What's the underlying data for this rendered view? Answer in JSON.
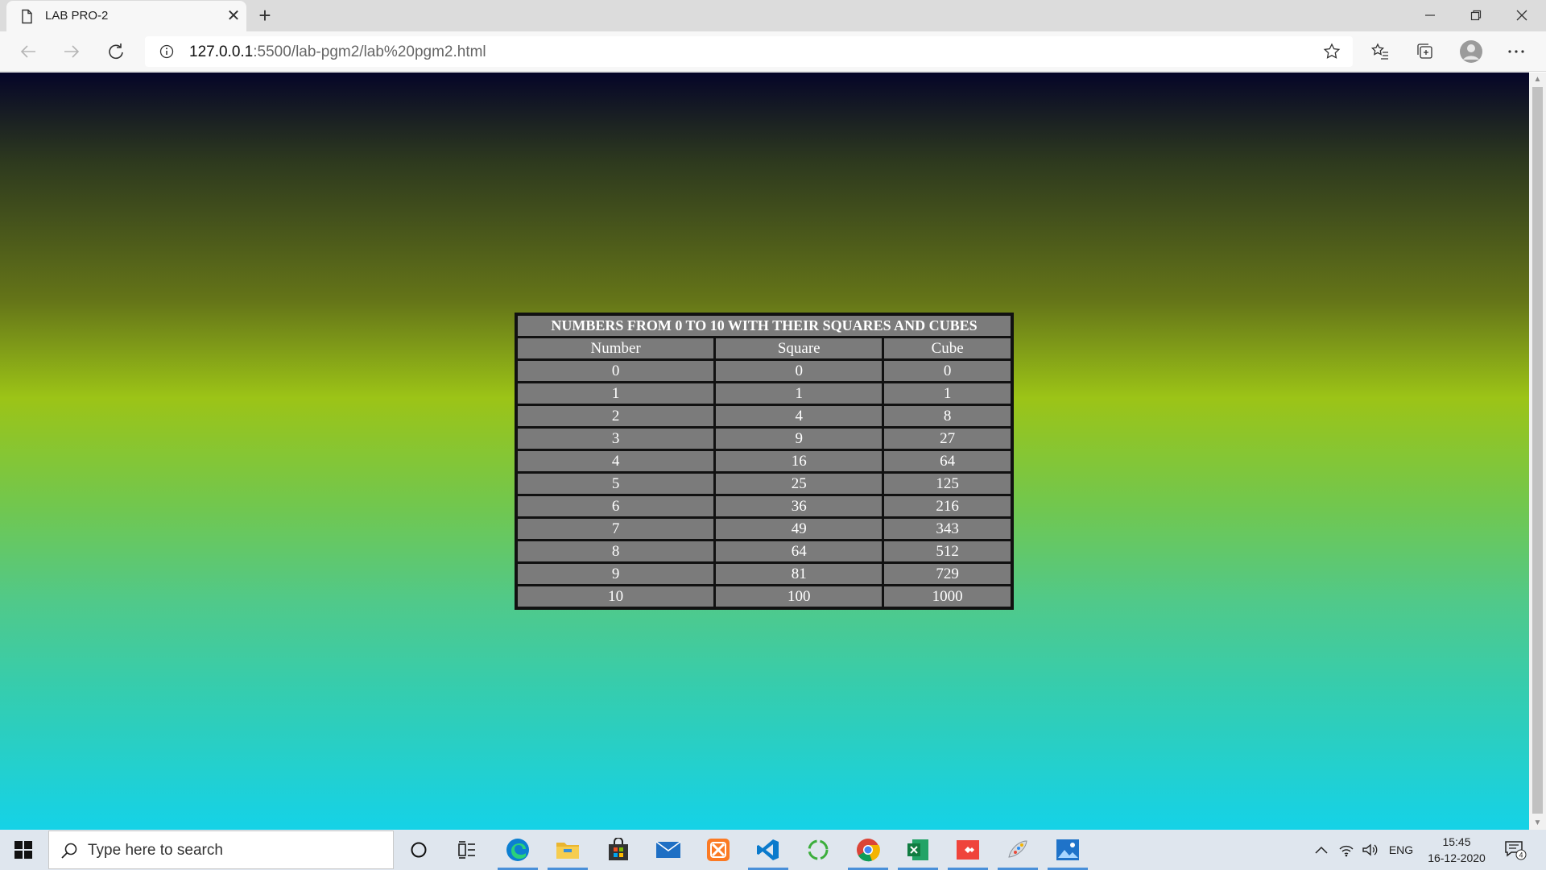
{
  "browser": {
    "tab_title": "LAB PRO-2",
    "url_host": "127.0.0.1",
    "url_rest": ":5500/lab-pgm2/lab%20pgm2.html"
  },
  "page": {
    "table": {
      "caption": "NUMBERS FROM 0 TO 10 WITH THEIR SQUARES AND CUBES",
      "headers": [
        "Number",
        "Square",
        "Cube"
      ],
      "rows": [
        [
          "0",
          "0",
          "0"
        ],
        [
          "1",
          "1",
          "1"
        ],
        [
          "2",
          "4",
          "8"
        ],
        [
          "3",
          "9",
          "27"
        ],
        [
          "4",
          "16",
          "64"
        ],
        [
          "5",
          "25",
          "125"
        ],
        [
          "6",
          "36",
          "216"
        ],
        [
          "7",
          "49",
          "343"
        ],
        [
          "8",
          "64",
          "512"
        ],
        [
          "9",
          "81",
          "729"
        ],
        [
          "10",
          "100",
          "1000"
        ]
      ]
    }
  },
  "taskbar": {
    "search_placeholder": "Type here to search",
    "language": "ENG",
    "time": "15:45",
    "date": "16-12-2020",
    "notification_count": "4"
  }
}
